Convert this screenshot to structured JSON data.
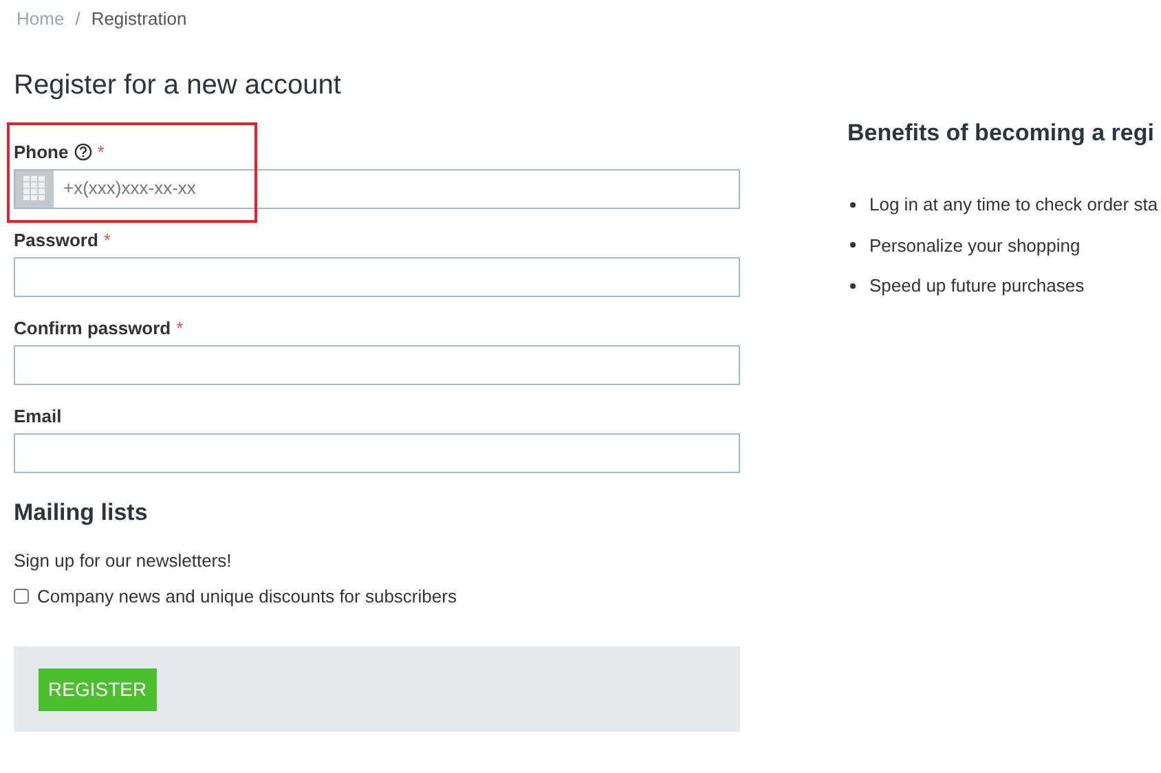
{
  "breadcrumb": [
    {
      "label": "Home",
      "current": false
    },
    {
      "label": "Registration",
      "current": true
    }
  ],
  "breadcrumb_separator": "/",
  "title": "Register for a new account",
  "fields": [
    {
      "kind": "phone",
      "label": "Phone",
      "help": true,
      "required": true,
      "highlighted": true,
      "placeholder": "+x(xxx)xxx-xx-xx"
    },
    {
      "kind": "password",
      "label": "Password",
      "help": false,
      "required": true,
      "highlighted": false
    },
    {
      "kind": "password",
      "label": "Confirm password",
      "help": false,
      "required": true,
      "highlighted": false
    },
    {
      "kind": "text",
      "label": "Email",
      "help": false,
      "required": false,
      "highlighted": false
    }
  ],
  "required_mark": "*",
  "mailing": {
    "heading": "Mailing lists",
    "intro": "Sign up for our newsletters!",
    "options": [
      {
        "label": "Company news and unique discounts for subscribers",
        "checked": false
      }
    ]
  },
  "register_button": "REGISTER",
  "benefits": {
    "heading": "Benefits of becoming a regi",
    "items": [
      "Log in at any time to check order sta",
      "Personalize your shopping",
      "Speed up future purchases"
    ]
  }
}
